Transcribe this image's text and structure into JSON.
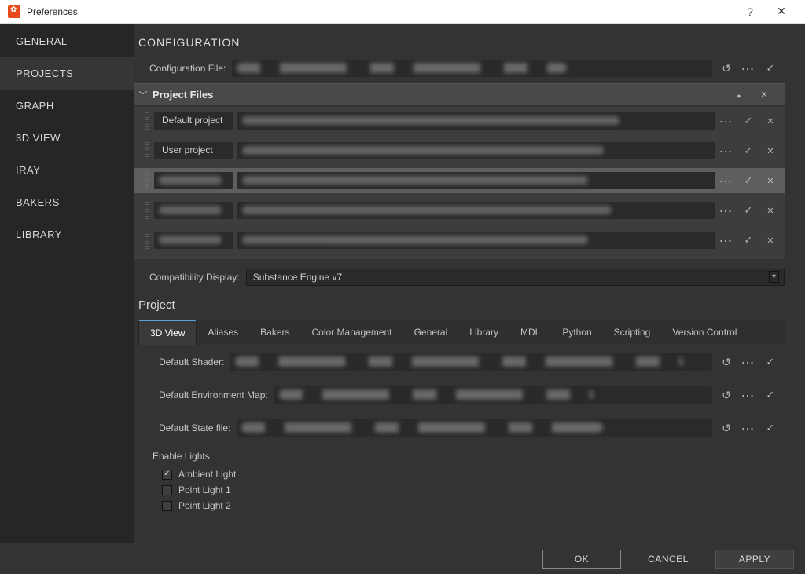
{
  "window": {
    "title": "Preferences"
  },
  "sidebar": {
    "items": [
      {
        "label": "GENERAL"
      },
      {
        "label": "PROJECTS"
      },
      {
        "label": "GRAPH"
      },
      {
        "label": "3D VIEW"
      },
      {
        "label": "IRAY"
      },
      {
        "label": "BAKERS"
      },
      {
        "label": "LIBRARY"
      }
    ],
    "active_index": 1
  },
  "config": {
    "heading": "CONFIGURATION",
    "file_label": "Configuration File:"
  },
  "project_files": {
    "title": "Project Files",
    "rows": [
      {
        "label": "Default project"
      },
      {
        "label": "User project"
      },
      {
        "label": ""
      },
      {
        "label": ""
      },
      {
        "label": ""
      }
    ]
  },
  "compat": {
    "label": "Compatibility Display:",
    "value": "Substance Engine v7"
  },
  "project": {
    "heading": "Project",
    "tabs": [
      "3D View",
      "Aliases",
      "Bakers",
      "Color Management",
      "General",
      "Library",
      "MDL",
      "Python",
      "Scripting",
      "Version Control"
    ],
    "active_tab": 0,
    "default_shader_label": "Default Shader:",
    "default_env_label": "Default Environment Map:",
    "default_state_label": "Default State file:",
    "lights_heading": "Enable Lights",
    "lights": [
      {
        "label": "Ambient Light",
        "checked": true
      },
      {
        "label": "Point Light 1",
        "checked": false
      },
      {
        "label": "Point Light 2",
        "checked": false
      }
    ]
  },
  "footer": {
    "ok": "OK",
    "cancel": "CANCEL",
    "apply": "APPLY"
  }
}
